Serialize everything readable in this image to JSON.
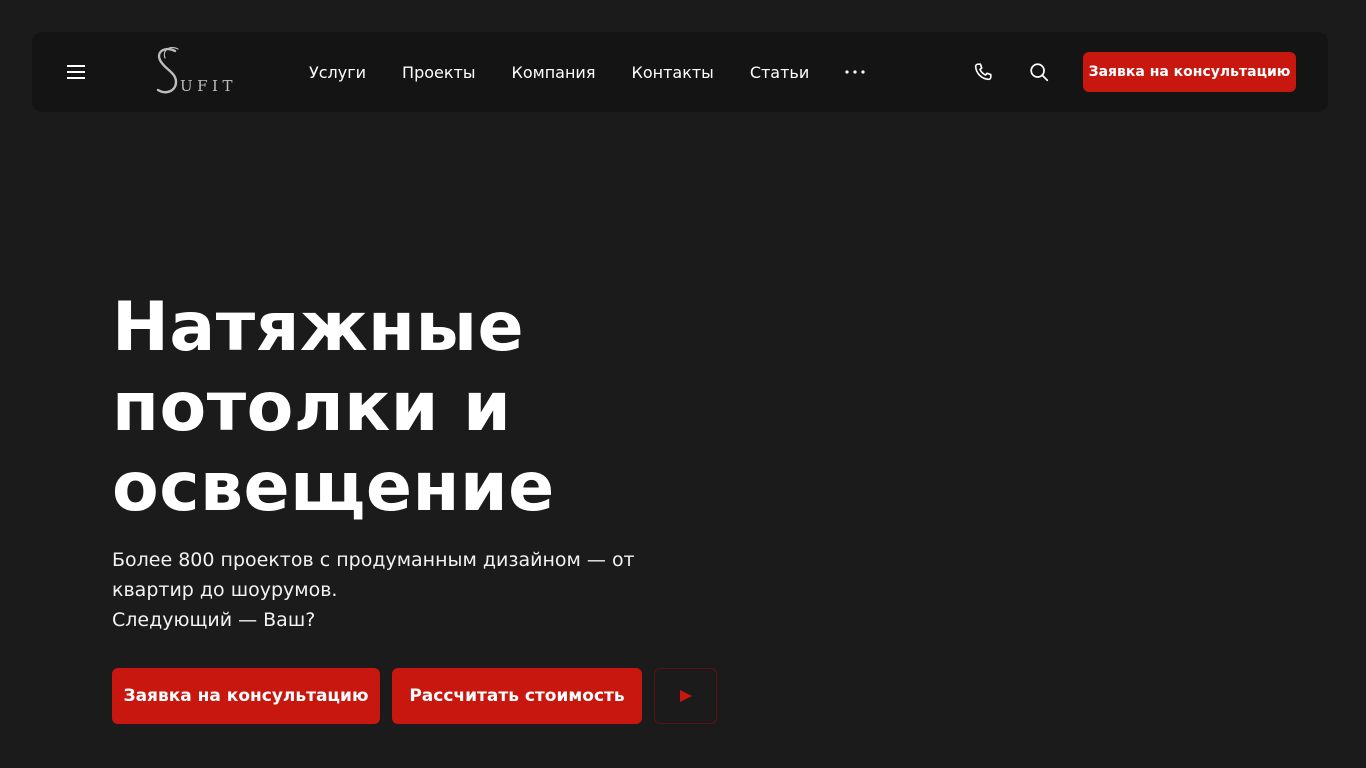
{
  "header": {
    "logo_text": "UFIT",
    "nav": [
      "Услуги",
      "Проекты",
      "Компания",
      "Контакты",
      "Статьи"
    ],
    "more_icon": "ellipsis-icon",
    "phone_icon": "phone-icon",
    "search_icon": "search-icon",
    "menu_icon": "hamburger-icon",
    "cta_label": "Заявка на консультацию"
  },
  "hero": {
    "title_lines": [
      "Натяжные",
      "потолки и",
      "освещение"
    ],
    "subtitle_lines": [
      "Более 800 проектов с продуманным дизайном — от",
      "квартир до шоурумов.",
      "Следующий — Ваш?"
    ],
    "primary_button": "Заявка на консультацию",
    "secondary_button": "Рассчитать стоимость",
    "play_icon": "play-icon"
  },
  "colors": {
    "background": "#1b1b1b",
    "header_bg": "#141414",
    "accent": "#c8170f",
    "text": "#ffffff"
  }
}
